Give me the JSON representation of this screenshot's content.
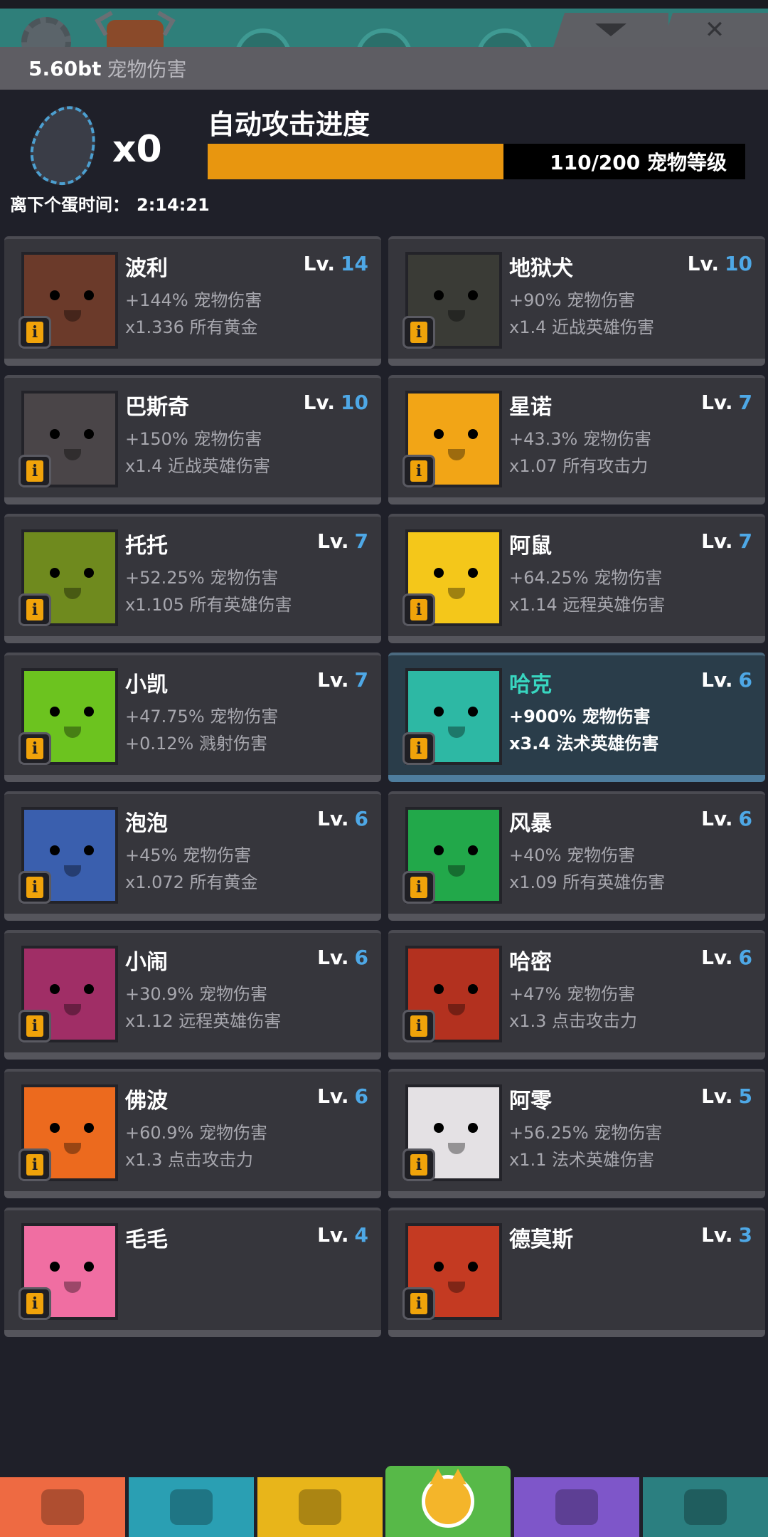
{
  "header": {
    "pet_damage_value": "5.60bt",
    "pet_damage_label": "宠物伤害"
  },
  "egg": {
    "count": "x0",
    "next_label": "离下个蛋时间：",
    "next_time": "2:14:21"
  },
  "auto_attack": {
    "title": "自动攻击进度",
    "progress_text": "110/200 宠物等级",
    "current": 110,
    "max": 200,
    "fill_color": "#e8960f"
  },
  "level_prefix": "Lv.",
  "info_glyph": "i",
  "pets": [
    {
      "name": "波利",
      "level": "14",
      "stat1": "+144% 宠物伤害",
      "stat2": "x1.336 所有黄金",
      "color": "#6b3a2a",
      "selected": false
    },
    {
      "name": "地狱犬",
      "level": "10",
      "stat1": "+90% 宠物伤害",
      "stat2": "x1.4 近战英雄伤害",
      "color": "#3a3b36",
      "selected": false
    },
    {
      "name": "巴斯奇",
      "level": "10",
      "stat1": "+150% 宠物伤害",
      "stat2": "x1.4 近战英雄伤害",
      "color": "#4a4548",
      "selected": false
    },
    {
      "name": "星诺",
      "level": "7",
      "stat1": "+43.3% 宠物伤害",
      "stat2": "x1.07 所有攻击力",
      "color": "#f2a516",
      "selected": false
    },
    {
      "name": "托托",
      "level": "7",
      "stat1": "+52.25% 宠物伤害",
      "stat2": "x1.105 所有英雄伤害",
      "color": "#6f8a1e",
      "selected": false
    },
    {
      "name": "阿鼠",
      "level": "7",
      "stat1": "+64.25% 宠物伤害",
      "stat2": "x1.14 远程英雄伤害",
      "color": "#f4c71a",
      "selected": false
    },
    {
      "name": "小凯",
      "level": "7",
      "stat1": "+47.75% 宠物伤害",
      "stat2": "+0.12% 溅射伤害",
      "color": "#6cc31f",
      "selected": false
    },
    {
      "name": "哈克",
      "level": "6",
      "stat1": "+900% 宠物伤害",
      "stat2": "x3.4 法术英雄伤害",
      "color": "#2db8a4",
      "selected": true
    },
    {
      "name": "泡泡",
      "level": "6",
      "stat1": "+45% 宠物伤害",
      "stat2": "x1.072 所有黄金",
      "color": "#3a5fae",
      "selected": false
    },
    {
      "name": "风暴",
      "level": "6",
      "stat1": "+40% 宠物伤害",
      "stat2": "x1.09 所有英雄伤害",
      "color": "#22a84a",
      "selected": false
    },
    {
      "name": "小闹",
      "level": "6",
      "stat1": "+30.9% 宠物伤害",
      "stat2": "x1.12 远程英雄伤害",
      "color": "#a02e66",
      "selected": false
    },
    {
      "name": "哈密",
      "level": "6",
      "stat1": "+47% 宠物伤害",
      "stat2": "x1.3 点击攻击力",
      "color": "#b3311f",
      "selected": false
    },
    {
      "name": "佛波",
      "level": "6",
      "stat1": "+60.9% 宠物伤害",
      "stat2": "x1.3 点击攻击力",
      "color": "#ec6a1e",
      "selected": false
    },
    {
      "name": "阿零",
      "level": "5",
      "stat1": "+56.25% 宠物伤害",
      "stat2": "x1.1 法术英雄伤害",
      "color": "#e4e1e4",
      "selected": false
    },
    {
      "name": "毛毛",
      "level": "4",
      "stat1": "",
      "stat2": "",
      "color": "#f06ea2",
      "selected": false
    },
    {
      "name": "德莫斯",
      "level": "3",
      "stat1": "",
      "stat2": "",
      "color": "#c43a22",
      "selected": false
    }
  ],
  "bottom_nav": [
    {
      "icon": "sword-icon",
      "color": "#ee6a42",
      "active": false
    },
    {
      "icon": "hero-icon",
      "color": "#2a9fb3",
      "active": false
    },
    {
      "icon": "armor-icon",
      "color": "#e8b51a",
      "active": false
    },
    {
      "icon": "pet-fox-icon",
      "color": "#57b948",
      "active": true
    },
    {
      "icon": "clan-icon",
      "color": "#7e56c9",
      "active": false
    },
    {
      "icon": "shop-icon",
      "color": "#2b7f80",
      "active": false
    }
  ]
}
